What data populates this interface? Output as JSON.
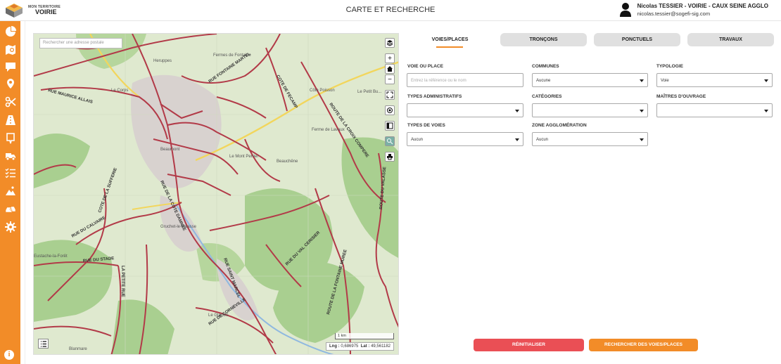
{
  "brand": {
    "line1": "MON TERRITOIRE",
    "line2": "VOIRIE"
  },
  "header": {
    "title": "CARTE ET RECHERCHE"
  },
  "user": {
    "name": "Nicolas TESSIER - VOIRIE - CAUX SEINE AGGLO",
    "email": "nicolas.tessier@sogefi-sig.com"
  },
  "sidebar": {
    "items": [
      "pie-chart-icon",
      "map-icon",
      "comment-icon",
      "map-marker-icon",
      "scissors-icon",
      "road-icon",
      "sign-icon",
      "truck-icon",
      "list-check-icon",
      "landslide-icon",
      "traffic-jam-icon",
      "settings-icon"
    ],
    "footer_icon": "info-icon"
  },
  "colors": {
    "accent": "#f28c28",
    "danger": "#ea4f55",
    "road": "#b23a48",
    "tab_bg": "#e0e0e0"
  },
  "map": {
    "search_placeholder": "Rechercher une adresse postale",
    "controls": [
      "layers-icon",
      "+",
      "home-icon",
      "−",
      "fullscreen-icon",
      "locate-icon",
      "sidebar-icon",
      "measure-icon",
      "print-icon"
    ],
    "scale_label": "1 km",
    "lng_label": "Lng :",
    "lng_value": "0,686975",
    "lat_label": "Lat :",
    "lat_value": "49,561182",
    "labels": [
      "Heruppes",
      "Fermes de Fontaine",
      "RUE FONTAINE MARTEL",
      "COTE DE FECAMP",
      "Le Corps",
      "RUE MAURICE ALLAIS",
      "Le Mont Perrier",
      "Beauchêne",
      "Ferme de Lavaux",
      "Le Petit Bu...",
      "Côte Poisson",
      "ROUTE DE LA CROIX COMPERE",
      "RUE DU CALVAIRE",
      "COTE DE LA SUFFERIE",
      "RUE DE LA COTE DAMNEE",
      "RUE DU STADE",
      "LA PETITE RUE",
      "RUE DU VAL CERISIER",
      "ROUTE DE LA FONTAINE MUREE",
      "RUE DE CORNEVILLE",
      "RUE SAINT MARCEL",
      "Gruchet-le-Valasse",
      "Eustache-la-Forêt",
      "Beaumont",
      "Le Glanois",
      "Blanmare",
      "ROUTE DU VALASSE"
    ]
  },
  "tabs": [
    "VOIES/PLACES",
    "TRONÇONS",
    "PONCTUELS",
    "TRAVAUX"
  ],
  "active_tab": "VOIES/PLACES",
  "form": {
    "voie_label": "VOIE OU PLACE",
    "voie_placeholder": "Entrez la référence ou le nom",
    "communes_label": "COMMUNES",
    "communes_value": "Aucune",
    "typologie_label": "TYPOLOGIE",
    "typologie_value": "Voie",
    "types_admin_label": "TYPES ADMINISTRATIFS",
    "types_admin_value": "",
    "categories_label": "CATÉGORIES",
    "categories_value": "",
    "maitres_label": "MAÎTRES D'OUVRAGE",
    "maitres_value": "",
    "types_voies_label": "TYPES DE VOIES",
    "types_voies_value": "Aucun",
    "zone_label": "ZONE AGGLOMÉRATION",
    "zone_value": "Aucun"
  },
  "actions": {
    "reset": "RÉINITIALISER",
    "search": "RECHERCHER DES VOIES/PLACES"
  }
}
